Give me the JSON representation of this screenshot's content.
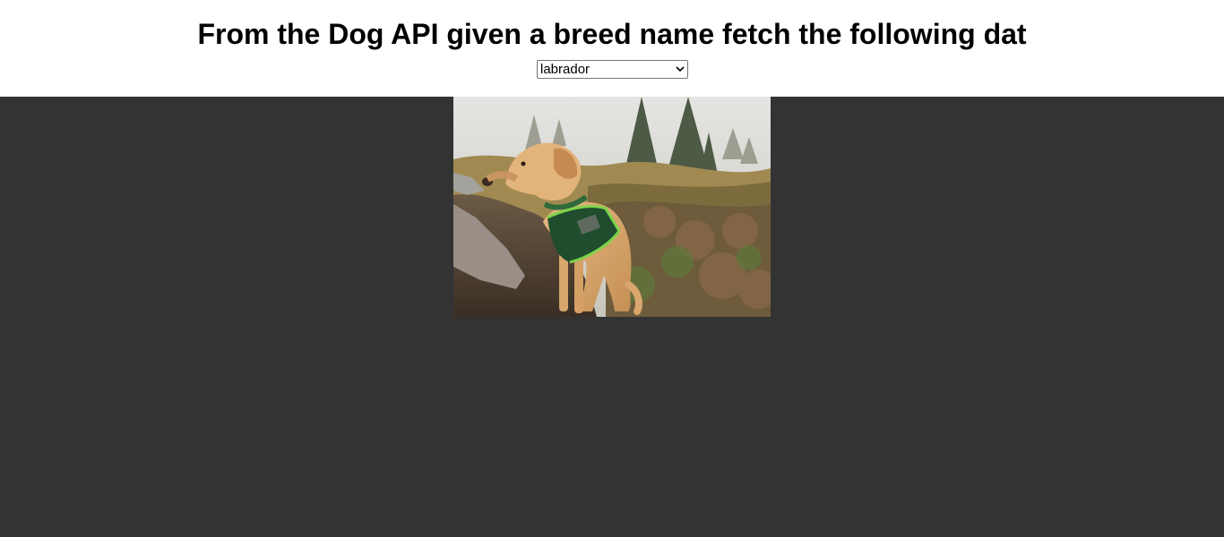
{
  "header": {
    "title": "From the Dog API given a breed name fetch the following dat"
  },
  "breed_select": {
    "selected": "labrador",
    "icon": "chevron-down-icon"
  },
  "image": {
    "subject": "labrador-photo",
    "colors": {
      "background": "#333333"
    }
  }
}
